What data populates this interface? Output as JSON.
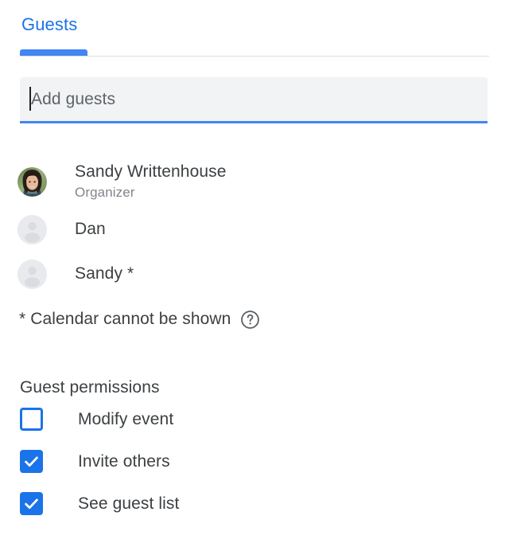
{
  "tabs": {
    "active_index": 0,
    "items": [
      {
        "label": "Guests"
      }
    ],
    "accent_color": "#1a73e8",
    "underline_color": "#4285f4"
  },
  "guest_input": {
    "value": "",
    "placeholder": "Add guests",
    "caret_visible": true,
    "background_color": "#f1f3f4",
    "underline_color": "#4285f4"
  },
  "guests": [
    {
      "name": "Sandy Writtenhouse",
      "role": "Organizer",
      "avatar": "photo-avatar"
    },
    {
      "name": "Dan",
      "role": "",
      "avatar": "person-placeholder-avatar"
    },
    {
      "name": "Sandy *",
      "role": "",
      "avatar": "person-placeholder-avatar"
    }
  ],
  "footnote": {
    "text": "* Calendar cannot be shown",
    "help_icon": "help-circle-icon"
  },
  "permissions": {
    "title": "Guest permissions",
    "items": [
      {
        "label": "Modify event",
        "checked": false
      },
      {
        "label": "Invite others",
        "checked": true
      },
      {
        "label": "See guest list",
        "checked": true
      }
    ],
    "checked_color": "#1a73e8"
  }
}
